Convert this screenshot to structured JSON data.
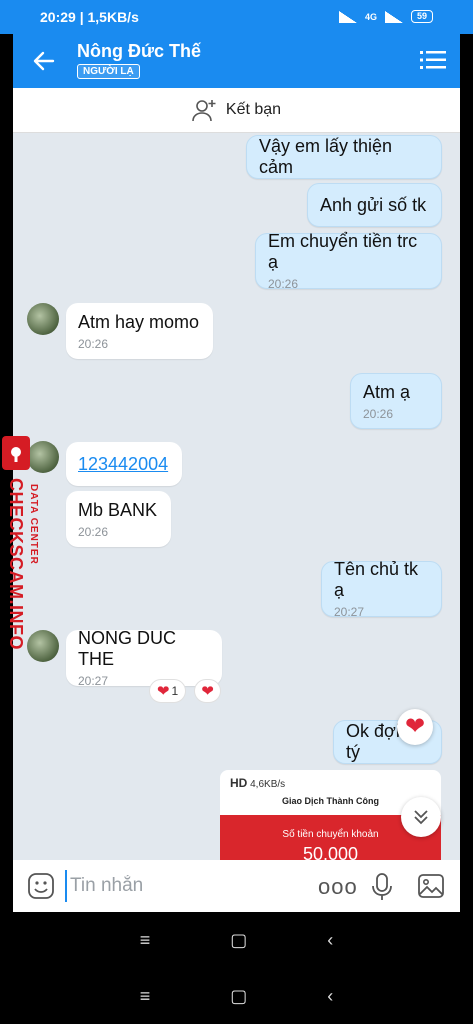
{
  "status_bar": {
    "time": "20:29 | 1,5KB/s",
    "indicators": "4G",
    "battery": "59"
  },
  "header": {
    "contact_name": "Nông Đức Thế",
    "badge": "NGƯỜI LẠ"
  },
  "friend_bar": {
    "label": "Kết bạn",
    "icon": "add-friend-icon"
  },
  "messages": [
    {
      "dir": "out",
      "text": "Vậy em lấy thiện cảm",
      "time": ""
    },
    {
      "dir": "out",
      "text": "Anh gửi số tk",
      "time": ""
    },
    {
      "dir": "out",
      "text": "Em chuyển tiền trc ạ",
      "time": "20:26"
    },
    {
      "dir": "in",
      "text": "Atm hay momo",
      "time": "20:26"
    },
    {
      "dir": "out",
      "text": "Atm ạ",
      "time": "20:26"
    },
    {
      "dir": "in",
      "text": "123442004",
      "time": ""
    },
    {
      "dir": "in",
      "text": "Mb BANK",
      "time": "20:26"
    },
    {
      "dir": "out",
      "text": "Tên chủ tk ạ",
      "time": "20:27"
    },
    {
      "dir": "in",
      "text": "NONG DUC THE",
      "time": "20:27"
    },
    {
      "dir": "out",
      "text": "Ok đợi e tý",
      "time": ""
    }
  ],
  "reactions": {
    "count": "1"
  },
  "shared_screenshot": {
    "status": "HD",
    "speed": "4,6KB/s",
    "title": "Giao Dịch Thành Công",
    "amount_label": "Số tiền chuyển khoản",
    "amount": "50.000"
  },
  "watermark": {
    "text": "CHECKSCAM.INFO",
    "sub": "DATA CENTER"
  },
  "input": {
    "placeholder": "Tin nhắn",
    "more": "ooo"
  },
  "nav": {
    "menu": "≡",
    "home": "▢",
    "back": "‹"
  },
  "colors": {
    "accent": "#1a8bf0",
    "outgoing": "#d4ecfd",
    "chat_bg": "#e2e8ee",
    "watermark": "#d51c24"
  }
}
